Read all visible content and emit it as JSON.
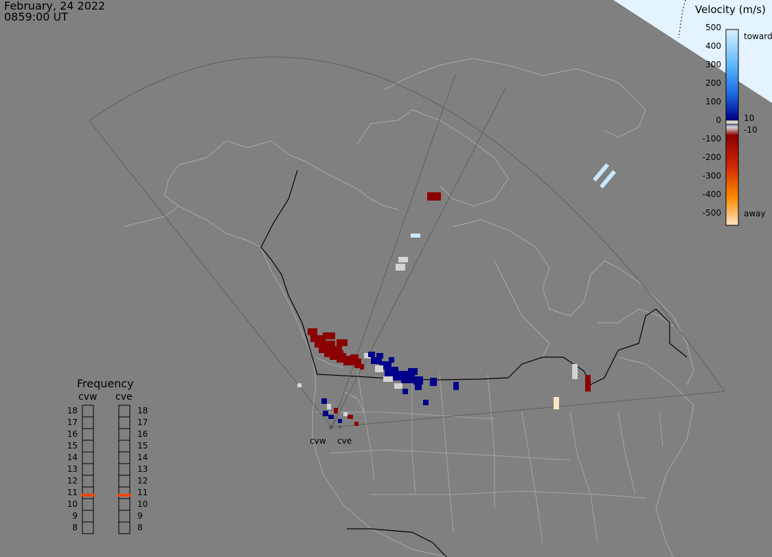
{
  "header": {
    "date": "February, 24 2022",
    "time": "0859:00 UT"
  },
  "velocity_legend": {
    "title": "Velocity (m/s)",
    "ticks": [
      "500",
      "400",
      "300",
      "200",
      "100",
      "0",
      "-100",
      "-200",
      "-300",
      "-400",
      "-500"
    ],
    "toward_label": "toward",
    "away_label": "away",
    "pos_threshold": "10",
    "neg_threshold": "-10",
    "colors": {
      "toward_max": "#c8e8ff",
      "toward_mid": "#1e90ff",
      "toward_low": "#00008b",
      "zero": "#d3d3d3",
      "away_low": "#8b0000",
      "away_mid": "#ff7f00",
      "away_max": "#ffe4c4"
    }
  },
  "frequency": {
    "title": "Frequency",
    "radars": [
      "cvw",
      "cve"
    ],
    "levels": [
      "18",
      "17",
      "16",
      "15",
      "14",
      "13",
      "12",
      "11",
      "10",
      "9",
      "8"
    ],
    "cvw_mhz": 10.8,
    "cve_mhz": 10.8,
    "indicator_color": "#ff4500"
  },
  "sites": {
    "west_label": "cvw",
    "east_label": "cve"
  }
}
